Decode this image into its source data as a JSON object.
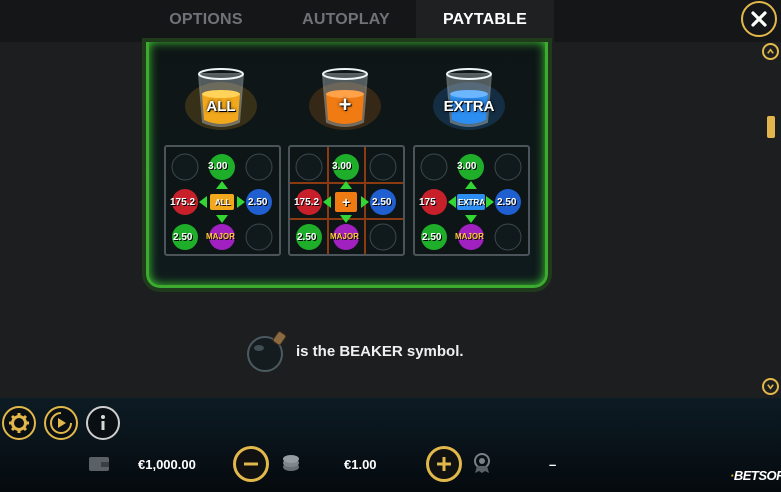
{
  "tabs": [
    {
      "label": "OPTIONS"
    },
    {
      "label": "AUTOPLAY"
    },
    {
      "label": "PAYTABLE",
      "active": true
    }
  ],
  "beakers": [
    {
      "label": "ALL",
      "color": "#f2a81c"
    },
    {
      "label": "+",
      "color": "#f07b12"
    },
    {
      "label": "EXTRA",
      "color": "#2c8ef0"
    }
  ],
  "examples": [
    {
      "top_value": "3.00",
      "left_value": "175.2",
      "right_value": "2.50",
      "bottom_left_value": "2.50",
      "center_tag": "ALL",
      "bottom_tag": "MAJOR"
    },
    {
      "top_value": "3.00",
      "left_value": "175.2",
      "right_value": "2.50",
      "bottom_left_value": "2.50",
      "center_tag": "+",
      "bottom_tag": "MAJOR"
    },
    {
      "top_value": "3.00",
      "left_value": "175",
      "right_value": "2.50",
      "bottom_left_value": "2.50",
      "center_tag": "EXTRA",
      "bottom_tag": "MAJOR"
    }
  ],
  "description": {
    "text": "is the BEAKER symbol."
  },
  "bottom_bar": {
    "balance": "€1,000.00",
    "bet": "€1.00",
    "win": "–",
    "logo_prefix": "·",
    "logo_main": "BETSOFT"
  },
  "colors": {
    "accent": "#e2b84a",
    "frame_green": "#3cab30"
  }
}
